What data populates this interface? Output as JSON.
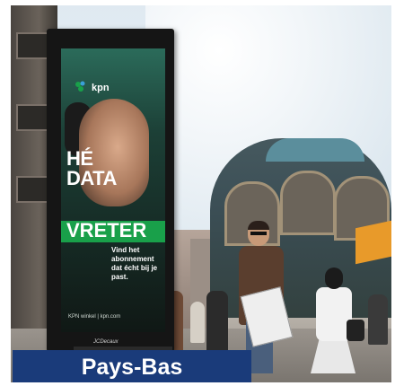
{
  "caption": {
    "text": "Pays-Bas",
    "bg_color": "#1a3b7a",
    "text_color": "#ffffff"
  },
  "billboard": {
    "brand": "kpn",
    "headline_line1": "HÉ",
    "headline_line2": "DATA",
    "headline_line3": "VRETER",
    "tagline": "Vind het abonnement dat écht bij je past.",
    "footer": "KPN winkel | kpn.com",
    "operator": "JCDecaux",
    "accent_color": "#19a04a"
  }
}
